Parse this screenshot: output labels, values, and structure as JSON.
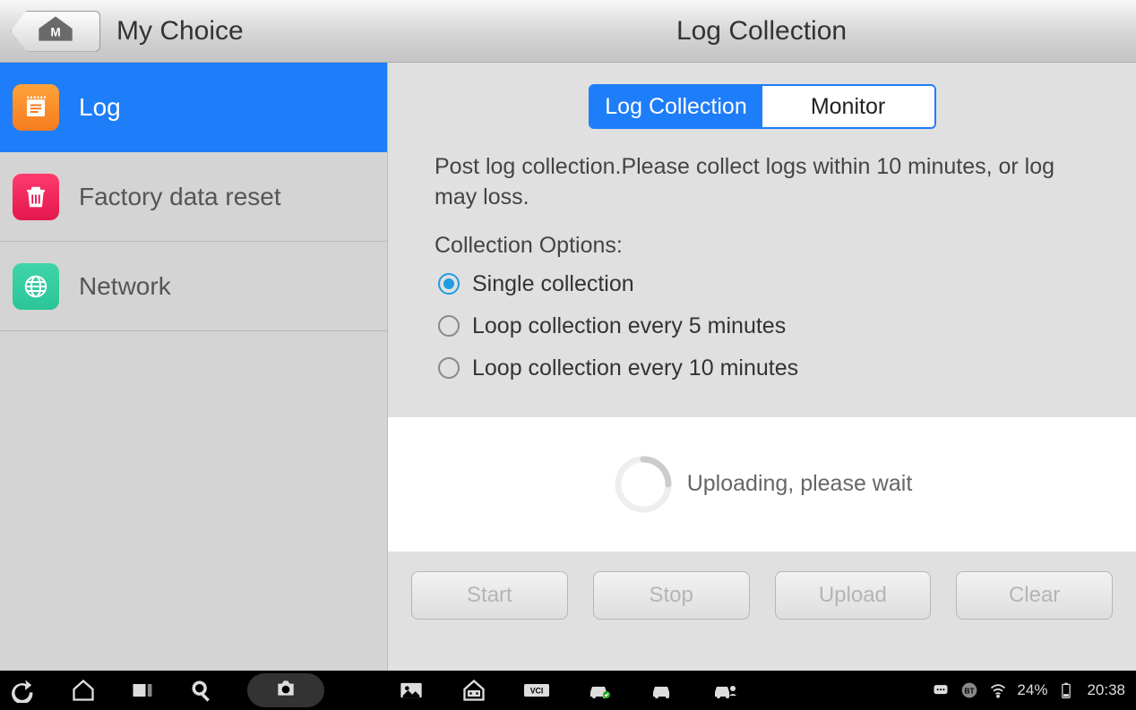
{
  "header": {
    "left_title": "My Choice",
    "right_title": "Log Collection"
  },
  "sidebar": {
    "items": [
      {
        "label": "Log"
      },
      {
        "label": "Factory data reset"
      },
      {
        "label": "Network"
      }
    ]
  },
  "segmented": {
    "tab0": "Log Collection",
    "tab1": "Monitor"
  },
  "instruction": "Post log collection.Please collect logs within 10 minutes, or log may loss.",
  "options": {
    "label": "Collection Options:",
    "opt0": "Single collection",
    "opt1": "Loop collection every 5 minutes",
    "opt2": "Loop collection every 10 minutes"
  },
  "status": {
    "text": "Uploading, please wait"
  },
  "buttons": {
    "start": "Start",
    "stop": "Stop",
    "upload": "Upload",
    "clear": "Clear"
  },
  "statusbar": {
    "battery_pct": "24%",
    "time": "20:38"
  }
}
